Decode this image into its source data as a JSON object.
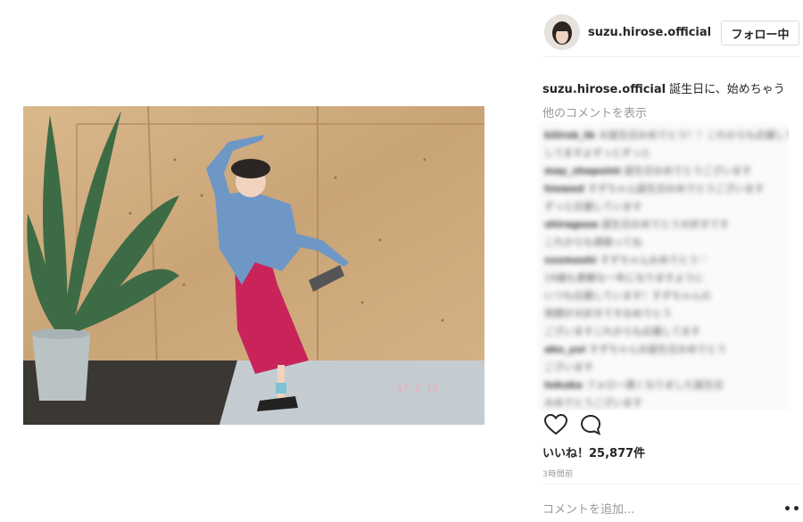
{
  "header": {
    "username": "suzu.hirose.official",
    "follow_label": "フォロー中"
  },
  "caption": {
    "username": "suzu.hirose.official",
    "text": "誕生日に、始めちゃう"
  },
  "more_comments_label": "他のコメントを表示",
  "photo": {
    "date_stamp": "'17 2 15"
  },
  "comments": [
    {
      "user": "kiiirok_tk",
      "text": "お誕生日おめでとう！！これからも応援しています"
    },
    {
      "user": "",
      "text": "してますよずっとずっと"
    },
    {
      "user": "may_shepoint",
      "text": "誕生日おめでとうございます"
    },
    {
      "user": "hiowed",
      "text": "すずちゃん誕生日おめでとうございます"
    },
    {
      "user": "",
      "text": "ずっと応援しています"
    },
    {
      "user": "shiragoza",
      "text": "誕生日おめでとう大好きです"
    },
    {
      "user": "",
      "text": "これからも頑張ってね"
    },
    {
      "user": "xxxmoshi",
      "text": "すずちゃんおめでとう♡"
    },
    {
      "user": "",
      "text": "19歳も素敵な一年になりますように"
    },
    {
      "user": "",
      "text": "いつも応援しています！すずちゃんの"
    },
    {
      "user": "",
      "text": "笑顔が大好きですおめでとう"
    },
    {
      "user": "",
      "text": "ございますこれからも応援してます"
    },
    {
      "user": "ako_yui",
      "text": "すずちゃんお誕生日おめでとう"
    },
    {
      "user": "",
      "text": "ございます"
    },
    {
      "user": "tokuka",
      "text": "フォロー遅くなりました誕生日"
    },
    {
      "user": "",
      "text": "おめでとうございます"
    }
  ],
  "actions": {
    "heart_icon": "heart-outline",
    "comment_icon": "speech-bubble-outline"
  },
  "likes": "いいね！25,877件",
  "time": "3時間前",
  "comment_input": {
    "placeholder": "コメントを追加...",
    "value": ""
  },
  "more_options_label": "•••"
}
